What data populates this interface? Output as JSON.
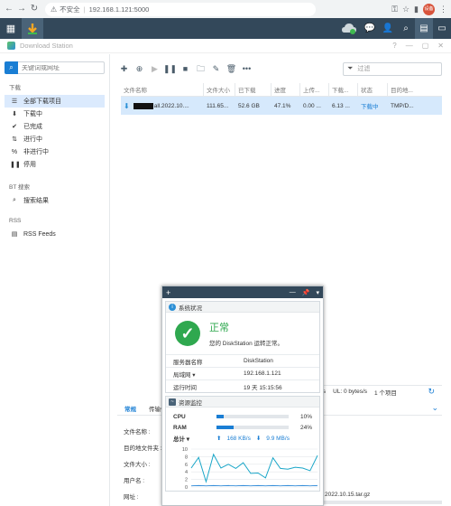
{
  "browser": {
    "security_label": "不安全",
    "url": "192.168.1.121:5000",
    "profile_initials": "设备"
  },
  "app": {
    "title": "Download Station"
  },
  "sidebar": {
    "search_placeholder": "关键词或网址",
    "section_download": "下载",
    "items": [
      {
        "label": "全部下载项目",
        "icon": "all-downloads"
      },
      {
        "label": "下载中",
        "icon": "downloading"
      },
      {
        "label": "已完成",
        "icon": "completed"
      },
      {
        "label": "进行中",
        "icon": "active"
      },
      {
        "label": "非进行中",
        "icon": "inactive"
      },
      {
        "label": "停用",
        "icon": "paused"
      }
    ],
    "section_bt": "BT 搜索",
    "bt_items": [
      {
        "label": "搜索结果",
        "icon": "search"
      }
    ],
    "section_rss": "RSS",
    "rss_items": [
      {
        "label": "RSS Feeds",
        "icon": "rss"
      }
    ]
  },
  "toolbar": {
    "filter_placeholder": "过滤"
  },
  "table": {
    "headers": [
      "文件名称",
      "文件大小",
      "已下载",
      "进度",
      "上传...",
      "下载...",
      "状态",
      "目的地..."
    ],
    "row": {
      "name_suffix": "all.2022.10....",
      "size": "111.65...",
      "downloaded": "52.6 GB",
      "progress": "47.1%",
      "upload": "0.00 ...",
      "download": "6.13 ...",
      "status": "下载中",
      "destination": "TMP/D..."
    }
  },
  "statusbar": {
    "dl": "/s",
    "ul": "UL: 0 bytes/s",
    "count": "1 个项目"
  },
  "detail": {
    "tabs": [
      "常规",
      "传输信"
    ],
    "fields": [
      "文件名称 :",
      "目的地文件夹 :",
      "文件大小 :",
      "用户名 :",
      "网址 :"
    ],
    "url_value": "2022.10.15.tar.gz"
  },
  "widget": {
    "health": {
      "title": "系统状况",
      "status": "正常",
      "desc": "您的 DiskStation 运转正常。",
      "server_name_label": "服务器名称",
      "server_name": "DiskStation",
      "lan_label": "局域网 ▾",
      "lan_ip": "192.168.1.121",
      "uptime_label": "运行时间",
      "uptime": "19 天 15:15:56"
    },
    "resource": {
      "title": "资源监控",
      "cpu_label": "CPU",
      "cpu_pct": "10%",
      "cpu_value": 10,
      "ram_label": "RAM",
      "ram_pct": "24%",
      "ram_value": 24,
      "total_label": "总计 ▾",
      "up_rate": "168 KB/s",
      "down_rate": "9.9 MB/s",
      "yticks": [
        "10",
        "8",
        "6",
        "4",
        "2",
        "0"
      ]
    }
  },
  "chart_data": {
    "type": "line",
    "title": "",
    "ylim": [
      0,
      10
    ],
    "series": [
      {
        "values": [
          5,
          7.8,
          1.4,
          8.6,
          5,
          6,
          4.9,
          6.4,
          3.6,
          3.7,
          2.4,
          7.7,
          4.9,
          4.7,
          5.2,
          5,
          4.3,
          8.3
        ]
      },
      {
        "values": [
          0.3,
          0.4,
          0.3,
          0.4,
          0.3,
          0.4,
          0.3,
          0.4,
          0.3,
          0.4,
          0.3,
          0.4,
          0.3,
          0.4,
          0.3,
          0.4,
          0.3,
          0.4
        ]
      }
    ]
  }
}
